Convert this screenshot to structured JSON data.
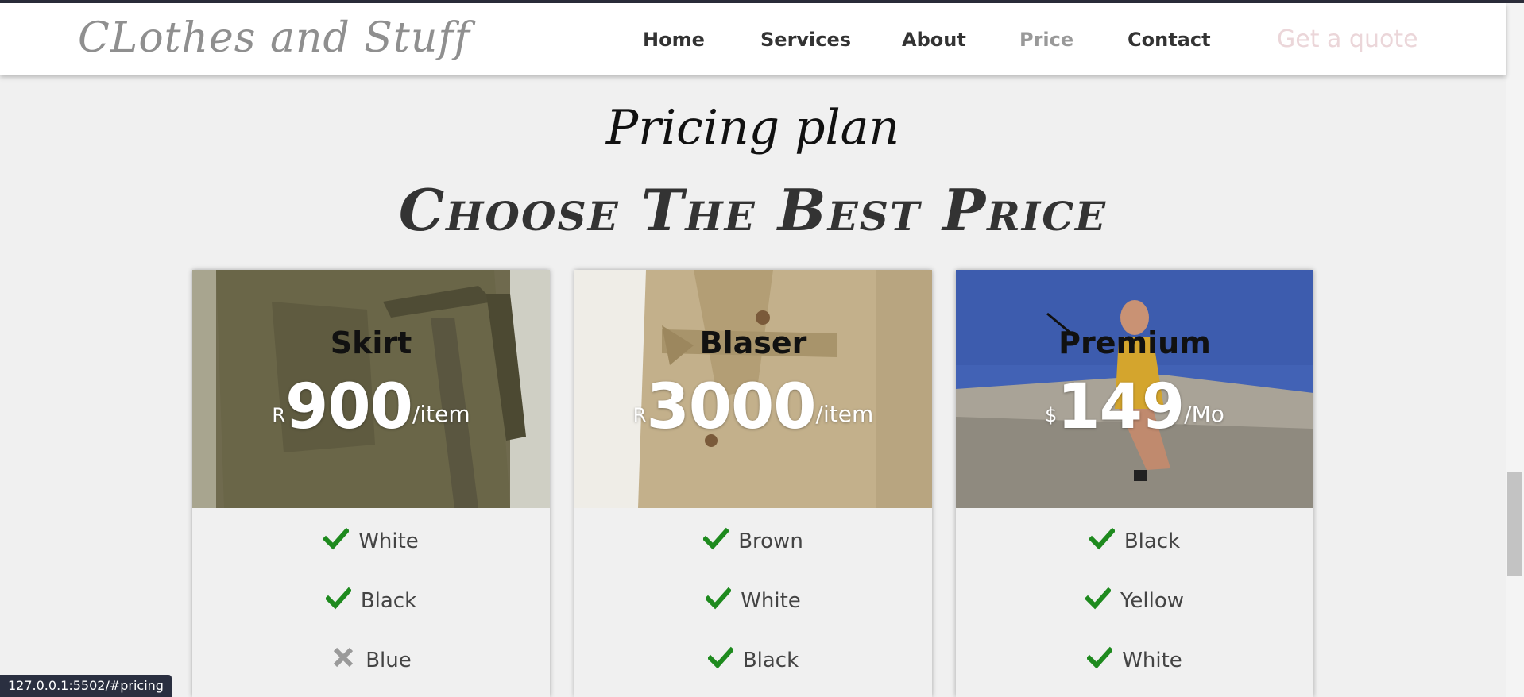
{
  "brand": {
    "logo": "CLothes and Stuff"
  },
  "nav": {
    "home": "Home",
    "services": "Services",
    "about": "About",
    "price": "Price",
    "contact": "Contact",
    "quote": "Get a quote"
  },
  "pricing": {
    "subtitle": "Pricing plan",
    "title": "Choose The Best Price"
  },
  "cards": [
    {
      "name": "Skirt",
      "currency": "R",
      "amount": "900",
      "unit": "/item",
      "features": [
        {
          "label": "White",
          "icon": "check-icon"
        },
        {
          "label": "Black",
          "icon": "check-icon"
        },
        {
          "label": "Blue",
          "icon": "cross-icon"
        }
      ]
    },
    {
      "name": "Blaser",
      "currency": "R",
      "amount": "3000",
      "unit": "/item",
      "features": [
        {
          "label": "Brown",
          "icon": "check-icon"
        },
        {
          "label": "White",
          "icon": "check-icon"
        },
        {
          "label": "Black",
          "icon": "check-icon"
        }
      ]
    },
    {
      "name": "Premium",
      "currency": "$",
      "amount": "149",
      "unit": "/Mo",
      "features": [
        {
          "label": "Black",
          "icon": "check-icon"
        },
        {
          "label": "Yellow",
          "icon": "check-icon"
        },
        {
          "label": "White",
          "icon": "check-icon"
        }
      ]
    }
  ],
  "status_bar": {
    "url": "127.0.0.1:5502/#pricing"
  },
  "colors": {
    "check": "#1e8a1e",
    "cross": "#9a9a9a",
    "logo": "#8f8f8f",
    "quote": "#ebd6d9"
  }
}
